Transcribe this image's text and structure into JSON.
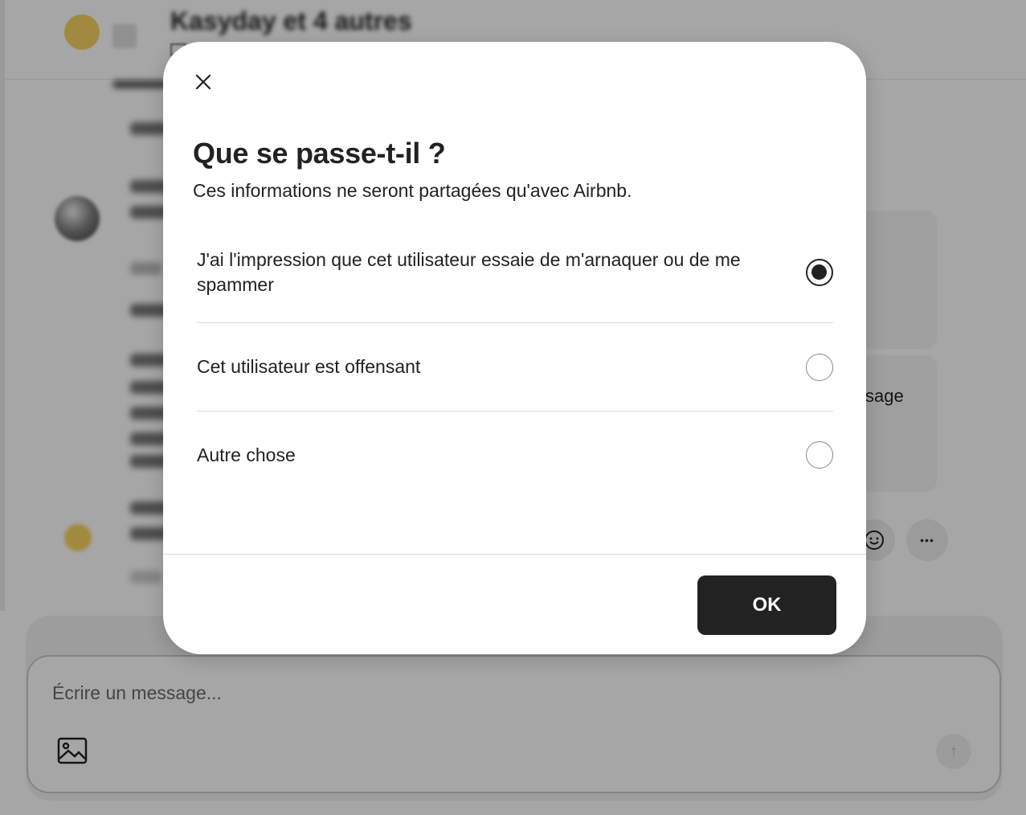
{
  "background": {
    "header_title": "Kasyday et 4 autres",
    "side_card_text": "sage",
    "emoji_icon": "smiley-icon",
    "more_icon": "more-horizontal-icon",
    "more_glyph": "•••",
    "composer": {
      "placeholder": "Écrire un message...",
      "image_icon": "image-icon",
      "send_icon": "arrow-up-icon",
      "send_glyph": "↑"
    }
  },
  "modal": {
    "close_icon": "close-icon",
    "title": "Que se passe-t-il ?",
    "subtitle": "Ces informations ne seront partagées qu'avec Airbnb.",
    "options": [
      {
        "label": "J'ai l'impression que cet utilisateur essaie de m'arnaquer ou de me spammer",
        "selected": true
      },
      {
        "label": "Cet utilisateur est offensant",
        "selected": false
      },
      {
        "label": "Autre chose",
        "selected": false
      }
    ],
    "ok_label": "OK"
  },
  "colors": {
    "overlay": "#000000",
    "primary_button": "#222222",
    "avatar_yellow": "#f7d562"
  }
}
